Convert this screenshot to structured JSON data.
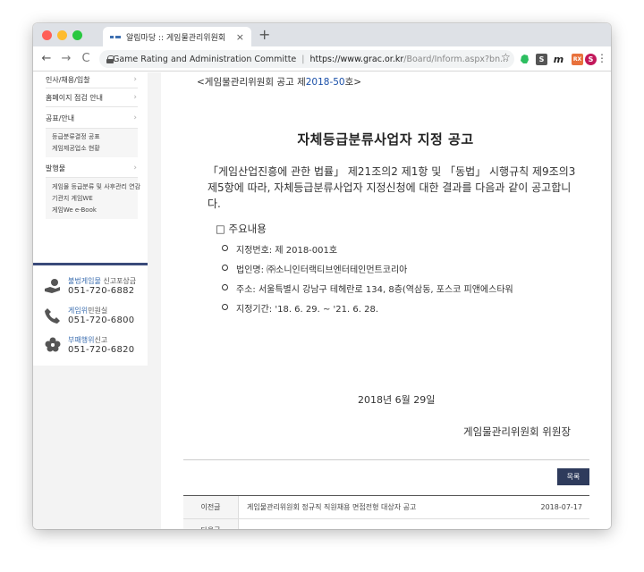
{
  "browser": {
    "tab_title": "알림마당 :: 게임물관리위원회",
    "tab_close": "×",
    "new_tab": "+",
    "back": "←",
    "forward": "→",
    "reload": "C",
    "org_name": "Game Rating and Administration Committe",
    "url_host": "https://www.grac.or.kr",
    "url_path": "/Board/Inform.aspx?bn...",
    "bookmark": "☆",
    "ext_s": "S",
    "ext_m": "m",
    "ext_rx": "RX",
    "profile": "S",
    "menu": "⋮"
  },
  "sidebar": {
    "items": [
      {
        "label": "인사/채용/입찰",
        "chev": "›"
      },
      {
        "label": "홈페이지 점검 안내",
        "chev": "›"
      },
      {
        "label": "공표/안내",
        "chev": "›"
      },
      {
        "label": "발행물",
        "chev": "›"
      }
    ],
    "sub_notice": [
      "등급분류결정 공표",
      "게임제공업소 현황"
    ],
    "sub_pub": [
      "게임물 등급분류 및 사후관리 연감",
      "기관지 게임WE",
      "게임We e-Book"
    ],
    "contacts": [
      {
        "label_hl": "불법게임물",
        "label_rest": " 신고포상금",
        "phone": "051-720-6882"
      },
      {
        "label_hl": "게임위",
        "label_rest": "민원실",
        "phone": "051-720-6800"
      },
      {
        "label_hl": "부패행위",
        "label_rest": "신고",
        "phone": "051-720-6820"
      }
    ]
  },
  "notice": {
    "number_prefix": "<게임물관리위원회 공고 제",
    "number_hl": "2018-50",
    "number_suffix": "호>",
    "title": "자체등급분류사업자 지정 공고",
    "body": "「게임산업진흥에 관한 법률」 제21조의2 제1항 및 「동법」 시행규칙 제9조의3 제5항에 따라, 자체등급분류사업자 지정신청에 대한 결과를 다음과 같이 공고합니다.",
    "section_title": "□ 주요내용",
    "details": [
      "지정번호: 제 2018-001호",
      "법인명: ㈜소니인터랙티브엔터테인먼트코리아",
      "주소: 서울특별시 강남구 테헤란로 134, 8층(역삼동, 포스코 피앤에스타워",
      "지정기간: '18. 6. 29. ~ '21. 6. 28."
    ],
    "date": "2018년 6월 29일",
    "signature": "게임물관리위원회 위원장"
  },
  "list_button": "목록",
  "nav_rows": [
    {
      "label": "이전글",
      "title": "게임물관리위원회 정규직 직원채용 면접전형 대상자 공고",
      "date": "2018-07-17"
    },
    {
      "label": "다음글",
      "title": "",
      "date": ""
    }
  ]
}
